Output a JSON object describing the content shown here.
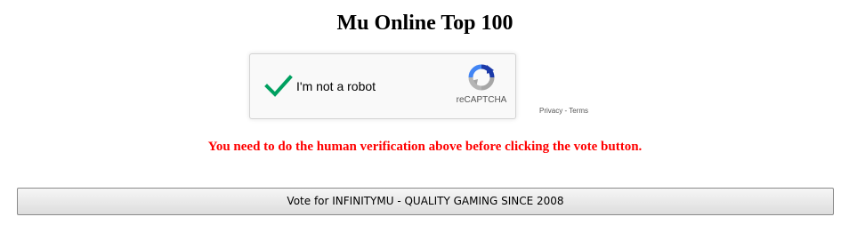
{
  "page": {
    "title": "Mu Online Top 100"
  },
  "recaptcha": {
    "checkbox_label": "I'm not a robot",
    "brand": "reCAPTCHA",
    "checked": true,
    "check_color": "#00a060",
    "privacy_label": "Privacy",
    "separator": " - ",
    "terms_label": "Terms"
  },
  "warning": {
    "message": "You need to do the human verification above before clicking the vote button.",
    "color": "#ff0000"
  },
  "vote": {
    "button_label": "Vote for INFINITYMU - QUALITY GAMING SINCE 2008"
  },
  "icons": {
    "check": "checkmark-icon",
    "recaptcha_logo": "recaptcha-logo-icon"
  }
}
